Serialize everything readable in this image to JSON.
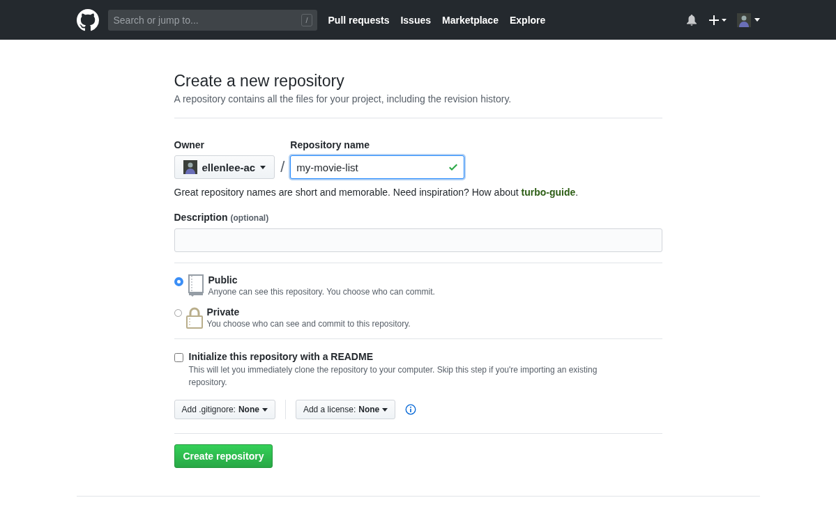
{
  "header": {
    "search": {
      "placeholder": "Search or jump to...",
      "shortcut": "/"
    },
    "nav": [
      "Pull requests",
      "Issues",
      "Marketplace",
      "Explore"
    ]
  },
  "page": {
    "title": "Create a new repository",
    "subtitle": "A repository contains all the files for your project, including the revision history."
  },
  "owner": {
    "label": "Owner",
    "value": "ellenlee-ac"
  },
  "separator": "/",
  "repo_name": {
    "label": "Repository name",
    "value": "my-movie-list",
    "valid": true
  },
  "name_hint": {
    "before": "Great repository names are short and memorable. Need inspiration? How about ",
    "link": "turbo-guide",
    "after": "."
  },
  "description": {
    "label": "Description",
    "hint": "(optional)"
  },
  "visibility": [
    {
      "kind": "public",
      "label": "Public",
      "detail": "Anyone can see this repository. You choose who can commit.",
      "selected": true
    },
    {
      "kind": "private",
      "label": "Private",
      "detail": "You choose who can see and commit to this repository.",
      "selected": false
    }
  ],
  "readme": {
    "label": "Initialize this repository with a README",
    "detail": "This will let you immediately clone the repository to your computer. Skip this step if you're importing an existing repository.",
    "checked": false
  },
  "dropdowns": [
    {
      "label": "Add .gitignore:",
      "value": "None"
    },
    {
      "label": "Add a license:",
      "value": "None"
    }
  ],
  "submit": "Create repository"
}
